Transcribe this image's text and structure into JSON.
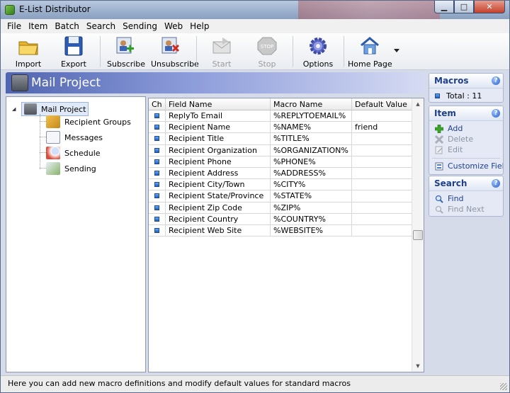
{
  "window": {
    "title": "E-List Distributor"
  },
  "menu": [
    "File",
    "Item",
    "Batch",
    "Search",
    "Sending",
    "Web",
    "Help"
  ],
  "toolbar": {
    "import": "Import",
    "export": "Export",
    "subscribe": "Subscribe",
    "unsubscribe": "Unsubscribe",
    "start": "Start",
    "stop": "Stop",
    "options": "Options",
    "home_page": "Home Page"
  },
  "header": {
    "title": "Mail Project"
  },
  "tree": {
    "root": "Mail Project",
    "children": [
      "Recipient Groups",
      "Messages",
      "Schedule",
      "Sending"
    ]
  },
  "grid": {
    "columns": [
      "Ch",
      "Field Name",
      "Macro Name",
      "Default Value"
    ],
    "rows": [
      {
        "field": "ReplyTo Email",
        "macro": "%REPLYTOEMAIL%",
        "default": ""
      },
      {
        "field": "Recipient Name",
        "macro": "%NAME%",
        "default": "friend"
      },
      {
        "field": "Recipient Title",
        "macro": "%TITLE%",
        "default": ""
      },
      {
        "field": "Recipient Organization",
        "macro": "%ORGANIZATION%",
        "default": ""
      },
      {
        "field": "Recipient Phone",
        "macro": "%PHONE%",
        "default": ""
      },
      {
        "field": "Recipient Address",
        "macro": "%ADDRESS%",
        "default": ""
      },
      {
        "field": "Recipient City/Town",
        "macro": "%CITY%",
        "default": ""
      },
      {
        "field": "Recipient State/Province",
        "macro": "%STATE%",
        "default": ""
      },
      {
        "field": "Recipient Zip Code",
        "macro": "%ZIP%",
        "default": ""
      },
      {
        "field": "Recipient Country",
        "macro": "%COUNTRY%",
        "default": ""
      },
      {
        "field": "Recipient Web Site",
        "macro": "%WEBSITE%",
        "default": ""
      }
    ]
  },
  "panels": {
    "macros": {
      "title": "Macros",
      "total": "Total : 11"
    },
    "item": {
      "title": "Item",
      "add": "Add",
      "delete": "Delete",
      "edit": "Edit",
      "customize": "Customize Fields"
    },
    "search": {
      "title": "Search",
      "find": "Find",
      "find_next": "Find Next"
    }
  },
  "status": {
    "text": "Here you can add new macro definitions and modify default values for standard macros"
  }
}
